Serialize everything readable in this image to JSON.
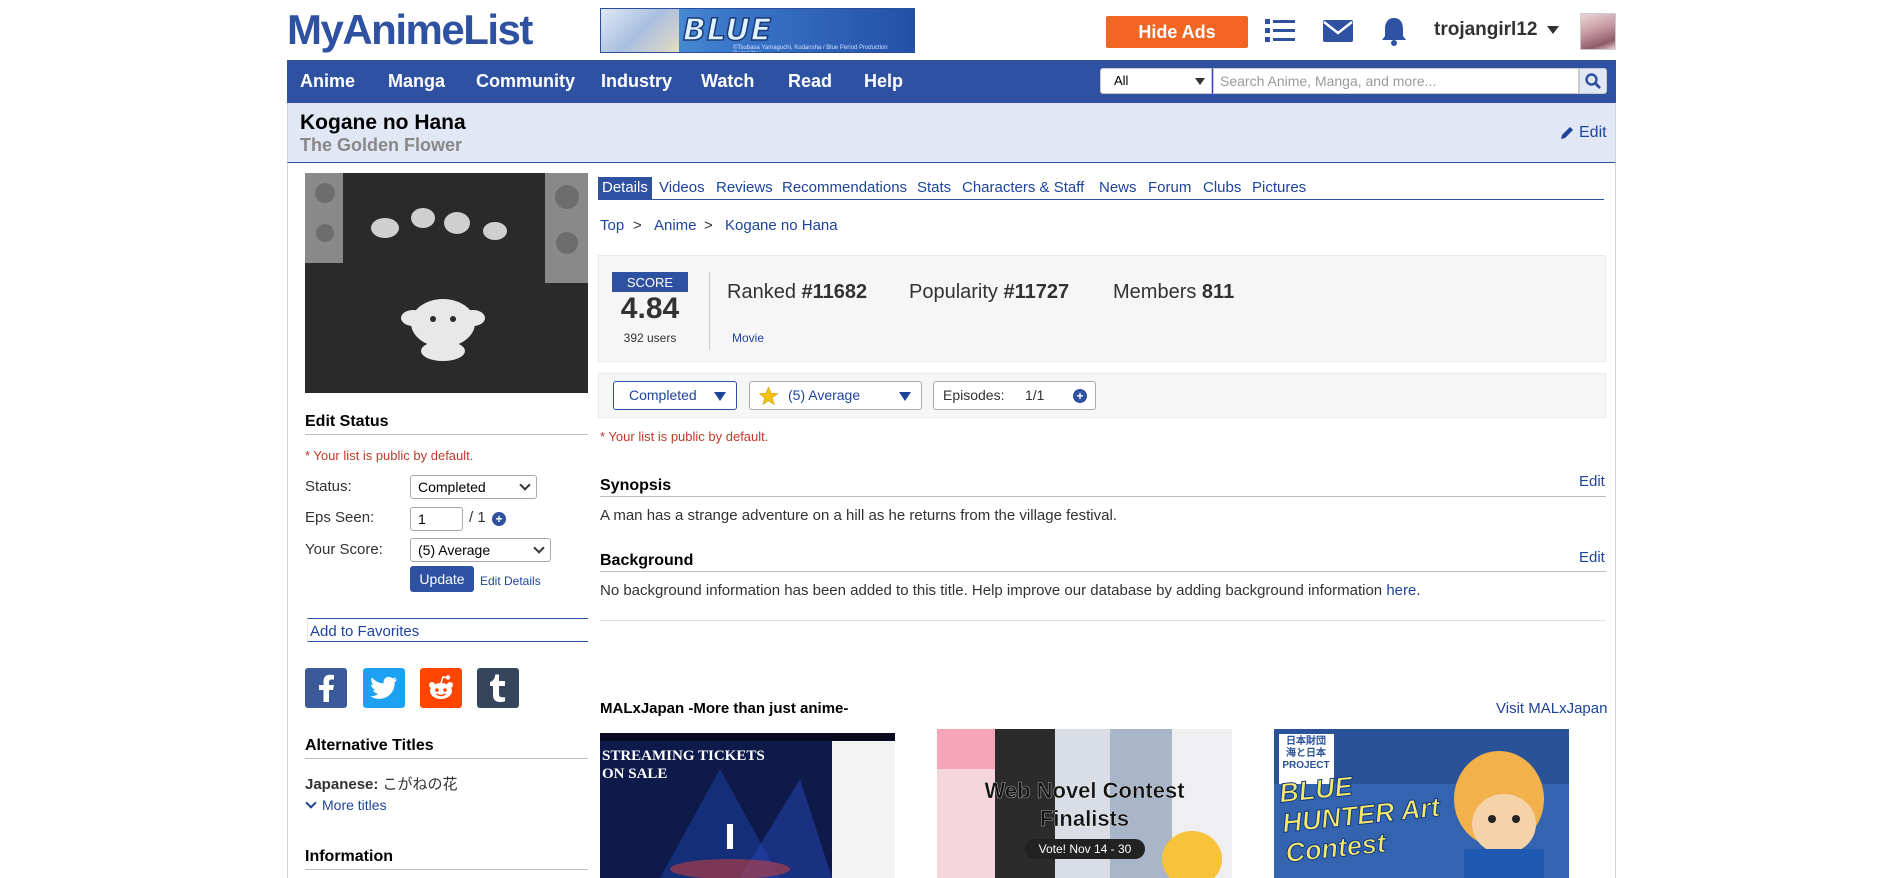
{
  "header": {
    "logo": "MyAnimeList",
    "banner_text": "BLUE PERIOD",
    "banner_small": "©Tsubasa Yamaguchi, Kodansha / Blue Period Production Committee",
    "hide_ads": "Hide Ads",
    "username": "trojangirl12"
  },
  "nav": {
    "items": [
      "Anime",
      "Manga",
      "Community",
      "Industry",
      "Watch",
      "Read",
      "Help"
    ],
    "search_category": "All",
    "search_placeholder": "Search Anime, Manga, and more..."
  },
  "title": {
    "main": "Kogane no Hana",
    "english": "The Golden Flower",
    "edit": "Edit"
  },
  "left": {
    "edit_status_heading": "Edit Status",
    "public_note": "* Your list is public by default.",
    "status_label": "Status:",
    "status_value": "Completed",
    "eps_label": "Eps Seen:",
    "eps_value": "1",
    "eps_total": "/ 1",
    "score_label": "Your Score:",
    "score_value": "(5) Average",
    "update": "Update",
    "edit_details": "Edit Details",
    "add_favorites": "Add to Favorites",
    "alt_titles_heading": "Alternative Titles",
    "japanese_label": "Japanese:",
    "japanese_value": "こがねの花",
    "more_titles": "More titles",
    "information_heading": "Information"
  },
  "tabs": [
    "Details",
    "Videos",
    "Reviews",
    "Recommendations",
    "Stats",
    "Characters & Staff",
    "News",
    "Forum",
    "Clubs",
    "Pictures"
  ],
  "breadcrumb": [
    "Top",
    "Anime",
    "Kogane no Hana"
  ],
  "breadcrumb_sep": ">",
  "stats": {
    "score_label": "SCORE",
    "score": "4.84",
    "users": "392 users",
    "ranked_label": "Ranked",
    "ranked": "#11682",
    "popularity_label": "Popularity",
    "popularity": "#11727",
    "members_label": "Members",
    "members": "811",
    "type": "Movie"
  },
  "user_status": {
    "status": "Completed",
    "score": "(5) Average",
    "episodes_label": "Episodes:",
    "episodes": "1/1",
    "public_note": "* Your list is public by default."
  },
  "synopsis": {
    "heading": "Synopsis",
    "edit": "Edit",
    "text": "A man has a strange adventure on a hill as he returns from the village festival."
  },
  "background": {
    "heading": "Background",
    "edit": "Edit",
    "text": "No background information has been added to this title. Help improve our database by adding background information ",
    "link": "here",
    "end": "."
  },
  "malxjapan": {
    "heading": "MALxJapan -More than just anime-",
    "visit": "Visit MALxJapan",
    "thumb1_text": "STREAMING TICKETS ON SALE",
    "thumb2_text": "Web Novel Contest Finalists",
    "thumb2_sub": "Vote! Nov 14 - 30",
    "thumb3_text": "BLUE HUNTER Art Contest",
    "thumb3_logo": "日本財団 海と日本 PROJECT"
  },
  "colors": {
    "brand": "#2e51a2",
    "accent": "#f26522",
    "link": "#1d439b",
    "light_bg": "#e1e7f5"
  }
}
